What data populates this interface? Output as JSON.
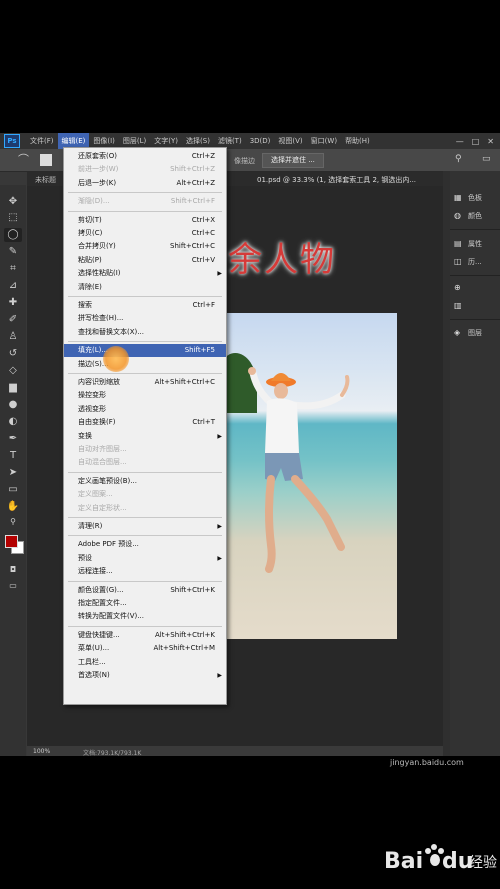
{
  "menubar": {
    "logo": "Ps",
    "items": [
      "文件(F)",
      "编辑(E)",
      "图像(I)",
      "图层(L)",
      "文字(Y)",
      "选择(S)",
      "滤镜(T)",
      "3D(D)",
      "视图(V)",
      "窗口(W)",
      "帮助(H)"
    ],
    "active_index": 1,
    "window_controls": [
      "—",
      "□",
      "✕"
    ]
  },
  "options_bar": {
    "partial_text": "像描边",
    "select_and_mask": "选择并遮住 ..."
  },
  "tab_bar": {
    "tab1": "未标题",
    "tab2": "01.psd @ 33.3% (1, 选择套索工具 2, 钢选出内..."
  },
  "overlay_title": "去掉多余人物",
  "edit_menu": {
    "items": [
      {
        "label": "还原套索(O)",
        "shortcut": "Ctrl+Z",
        "state": "normal"
      },
      {
        "label": "前进一步(W)",
        "shortcut": "Shift+Ctrl+Z",
        "state": "disabled"
      },
      {
        "label": "后退一步(K)",
        "shortcut": "Alt+Ctrl+Z",
        "state": "normal"
      },
      {
        "sep": true
      },
      {
        "label": "渐隐(D)...",
        "shortcut": "Shift+Ctrl+F",
        "state": "disabled"
      },
      {
        "sep": true
      },
      {
        "label": "剪切(T)",
        "shortcut": "Ctrl+X",
        "state": "normal"
      },
      {
        "label": "拷贝(C)",
        "shortcut": "Ctrl+C",
        "state": "normal"
      },
      {
        "label": "合并拷贝(Y)",
        "shortcut": "Shift+Ctrl+C",
        "state": "normal"
      },
      {
        "label": "粘贴(P)",
        "shortcut": "Ctrl+V",
        "state": "normal"
      },
      {
        "label": "选择性粘贴(I)",
        "submenu": true,
        "state": "normal"
      },
      {
        "label": "清除(E)",
        "state": "normal"
      },
      {
        "sep": true
      },
      {
        "label": "搜索",
        "shortcut": "Ctrl+F",
        "state": "normal"
      },
      {
        "label": "拼写检查(H)...",
        "state": "normal"
      },
      {
        "label": "查找和替换文本(X)...",
        "state": "normal"
      },
      {
        "sep": true
      },
      {
        "label": "填充(L)...",
        "shortcut": "Shift+F5",
        "state": "highlighted"
      },
      {
        "label": "描边(S)...",
        "state": "normal"
      },
      {
        "sep": true
      },
      {
        "label": "内容识别缩放",
        "shortcut": "Alt+Shift+Ctrl+C",
        "state": "normal"
      },
      {
        "label": "操控变形",
        "state": "normal"
      },
      {
        "label": "透视变形",
        "state": "normal"
      },
      {
        "label": "自由变换(F)",
        "shortcut": "Ctrl+T",
        "state": "normal"
      },
      {
        "label": "变换",
        "submenu": true,
        "state": "normal"
      },
      {
        "label": "自动对齐图层...",
        "state": "disabled"
      },
      {
        "label": "自动混合图层...",
        "state": "disabled"
      },
      {
        "sep": true
      },
      {
        "label": "定义画笔预设(B)...",
        "state": "normal"
      },
      {
        "label": "定义图案...",
        "state": "disabled"
      },
      {
        "label": "定义自定形状...",
        "state": "disabled"
      },
      {
        "sep": true
      },
      {
        "label": "清理(R)",
        "submenu": true,
        "state": "normal"
      },
      {
        "sep": true
      },
      {
        "label": "Adobe PDF 预设...",
        "state": "normal"
      },
      {
        "label": "预设",
        "submenu": true,
        "state": "normal"
      },
      {
        "label": "远程连接...",
        "state": "normal"
      },
      {
        "sep": true
      },
      {
        "label": "颜色设置(G)...",
        "shortcut": "Shift+Ctrl+K",
        "state": "normal"
      },
      {
        "label": "指定配置文件...",
        "state": "normal"
      },
      {
        "label": "转换为配置文件(V)...",
        "state": "normal"
      },
      {
        "sep": true
      },
      {
        "label": "键盘快捷键...",
        "shortcut": "Alt+Shift+Ctrl+K",
        "state": "normal"
      },
      {
        "label": "菜单(U)...",
        "shortcut": "Alt+Shift+Ctrl+M",
        "state": "normal"
      },
      {
        "label": "工具栏...",
        "state": "normal"
      },
      {
        "label": "首选项(N)",
        "submenu": true,
        "state": "normal"
      }
    ]
  },
  "right_panel": {
    "items": [
      {
        "icon": "color-icon",
        "glyph": "▦",
        "label": "色板"
      },
      {
        "icon": "swatches-icon",
        "glyph": "◍",
        "label": "颜色"
      },
      {
        "icon": "properties-icon",
        "glyph": "▤",
        "label": "属性"
      },
      {
        "icon": "adjustments-icon",
        "glyph": "◫",
        "label": "历..."
      },
      {
        "icon": "libraries-icon",
        "glyph": "⊕",
        "label": ""
      },
      {
        "icon": "paths-icon",
        "glyph": "▥",
        "label": ""
      },
      {
        "icon": "layers-icon",
        "glyph": "◈",
        "label": "图层"
      }
    ]
  },
  "status_bar": {
    "zoom": "100%",
    "doc_info": "文档:793.1K/793.1K"
  },
  "tools": [
    "move-tool-icon",
    "marquee-tool-icon",
    "lasso-tool-icon",
    "quick-select-tool-icon",
    "crop-tool-icon",
    "eyedropper-tool-icon",
    "healing-brush-tool-icon",
    "brush-tool-icon",
    "clone-stamp-tool-icon",
    "history-brush-tool-icon",
    "eraser-tool-icon",
    "gradient-tool-icon",
    "blur-tool-icon",
    "dodge-tool-icon",
    "pen-tool-icon",
    "type-tool-icon",
    "path-select-tool-icon",
    "shape-tool-icon",
    "hand-tool-icon",
    "zoom-tool-icon",
    "more-tools-icon"
  ],
  "colors": {
    "foreground": "#b20000",
    "background": "#ffffff",
    "menu_highlight": "#3f64b3",
    "title_red": "#d63a38"
  },
  "watermark": {
    "url": "jingyan.baidu.com",
    "brand": "Bai",
    "brand_suffix": "du",
    "brand_cn": "经验"
  }
}
